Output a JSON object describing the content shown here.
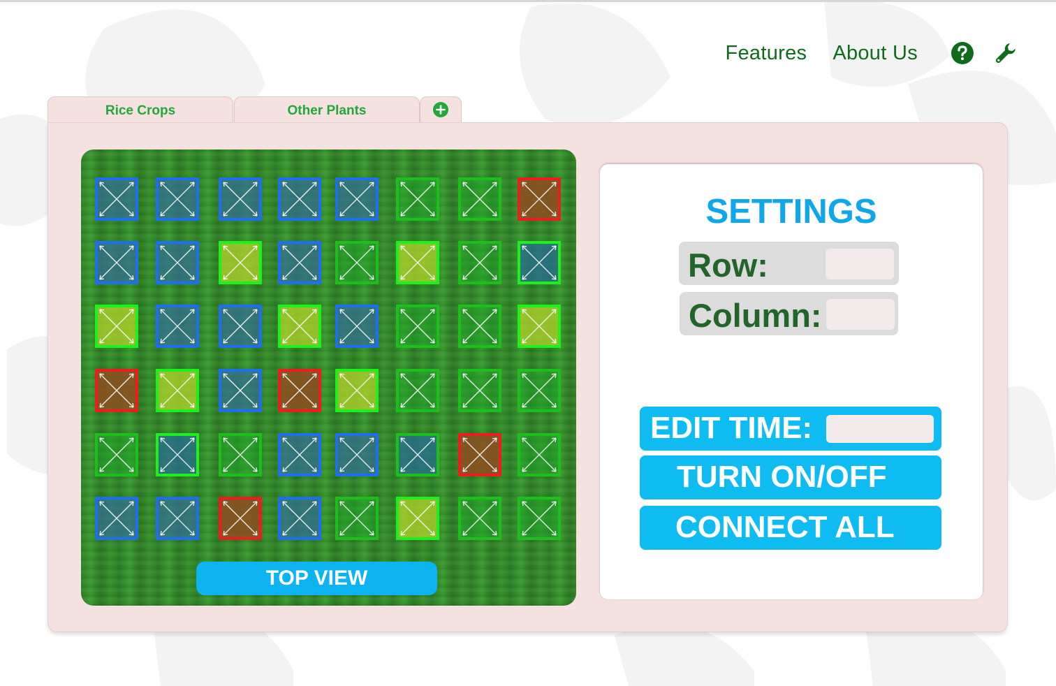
{
  "nav": {
    "features": "Features",
    "about": "About Us",
    "help_icon": "help-circle-icon",
    "settings_icon": "wrench-icon"
  },
  "tabs": [
    {
      "label": "Rice Crops"
    },
    {
      "label": "Other Plants"
    },
    {
      "label": "",
      "icon": "add-circle-icon"
    }
  ],
  "grid": {
    "rows": 6,
    "columns": 8,
    "cells": [
      [
        "blue",
        "blue",
        "blue",
        "blue",
        "blue",
        "green",
        "green",
        "red"
      ],
      [
        "blue",
        "blue",
        "lime",
        "blue",
        "green",
        "lime",
        "green",
        "teal-green"
      ],
      [
        "lime",
        "blue",
        "blue",
        "lime",
        "blue",
        "green",
        "green",
        "lime"
      ],
      [
        "red",
        "lime",
        "blue",
        "red",
        "lime",
        "green",
        "green",
        "green"
      ],
      [
        "green",
        "teal",
        "green",
        "blue",
        "blue",
        "teal-blue",
        "red",
        "green"
      ],
      [
        "blue",
        "blue",
        "red",
        "blue",
        "green",
        "lime",
        "green",
        "green"
      ]
    ]
  },
  "top_view": "TOP VIEW",
  "settings": {
    "title": "SETTINGS",
    "row_label": "Row:",
    "row_value": "",
    "column_label": "Column:",
    "column_value": "",
    "edit_time_label": "EDIT TIME:",
    "edit_time_value": "",
    "turn_on_off": "TURN ON/OFF",
    "connect_all": "CONNECT ALL"
  },
  "colors": {
    "brand_green": "#0e6b1c",
    "tab_text": "#21a838",
    "panel_bg": "#f6e1e1",
    "accent_blue": "#0ebcf2",
    "settings_title": "#10a7ea"
  }
}
